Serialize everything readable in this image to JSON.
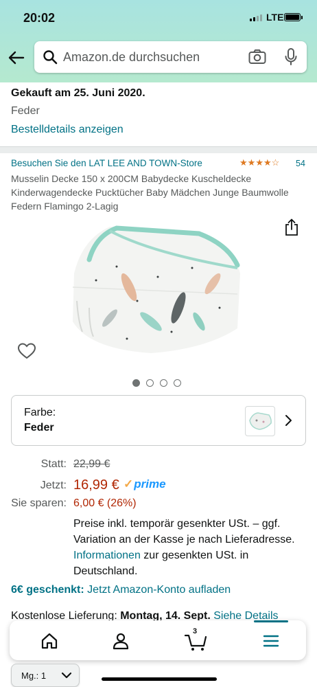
{
  "status_bar": {
    "time": "20:02",
    "network": "LTE"
  },
  "search": {
    "placeholder": "Amazon.de durchsuchen"
  },
  "order": {
    "purchased": "Gekauft am 25. Juni 2020.",
    "color": "Feder",
    "details_link": "Bestelldetails anzeigen"
  },
  "product": {
    "store_link": "Besuchen Sie den LAT LEE AND TOWN-Store",
    "rating_stars": 4.5,
    "rating_count": "54",
    "title": "Musselin Decke 150 x 200CM Babydecke Kuscheldecke Kinderwagendecke Pucktücher Baby Mädchen Junge Baumwolle Federn Flamingo 2-Lagig",
    "image_count": 4,
    "image_index": 1
  },
  "variant": {
    "label": "Farbe:",
    "value": "Feder"
  },
  "pricing": {
    "was_label": "Statt:",
    "was_price": "22,99 €",
    "now_label": "Jetzt:",
    "now_price": "16,99 €",
    "prime_label": "prime",
    "save_label": "Sie sparen:",
    "save_value": "6,00 € (26%)",
    "vat_text": "Preise inkl. temporär gesenkter USt. – ggf. Variation an der Kasse je nach Lieferadresse.",
    "vat_link": "Informationen",
    "vat_text2": " zur gesenkten USt. in Deutschland."
  },
  "promo": {
    "bold": "6€ geschenkt:",
    "text": " Jetzt Amazon-Konto aufladen"
  },
  "delivery": {
    "text": "Kostenlose Lieferung: ",
    "date": "Montag, 14. Sept.",
    "link": " Siehe Details"
  },
  "nav": {
    "cart_count": "3"
  },
  "quantity": {
    "label": "Mg.:",
    "value": "1"
  },
  "colors": {
    "link": "#007185",
    "price": "#b12704",
    "prime": "#1a98ff",
    "star": "#de7921",
    "header": "#a8e3e0"
  }
}
